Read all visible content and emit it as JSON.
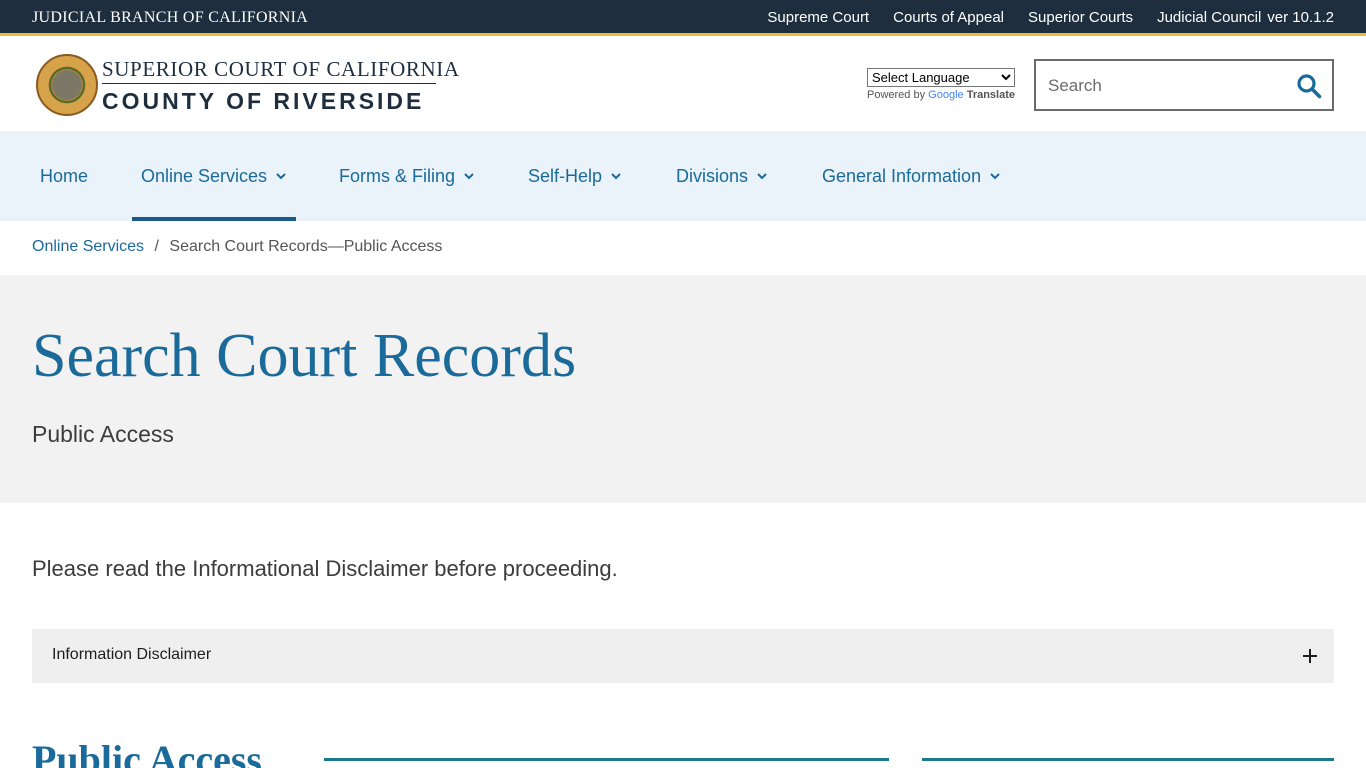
{
  "topbar": {
    "brand": "JUDICIAL BRANCH OF CALIFORNIA",
    "links": [
      "Supreme Court",
      "Courts of Appeal",
      "Superior Courts",
      "Judicial Council"
    ],
    "version": "ver 10.1.2"
  },
  "header": {
    "logo_line1": "SUPERIOR COURT OF CALIFORNIA",
    "logo_line2": "COUNTY OF RIVERSIDE",
    "language_select": "Select Language",
    "powered_by": "Powered by",
    "google": "Google",
    "translate": "Translate",
    "search_placeholder": "Search"
  },
  "nav": {
    "items": [
      {
        "label": "Home"
      },
      {
        "label": "Online Services"
      },
      {
        "label": "Forms & Filing"
      },
      {
        "label": "Self-Help"
      },
      {
        "label": "Divisions"
      },
      {
        "label": "General Information"
      }
    ]
  },
  "breadcrumb": {
    "parent": "Online Services",
    "separator": "/",
    "current": "Search Court Records—Public Access"
  },
  "hero": {
    "title": "Search Court Records",
    "subtitle": "Public Access"
  },
  "main": {
    "intro": "Please read the Informational Disclaimer before proceeding.",
    "accordion_label": "Information Disclaimer",
    "section_title": "Public Access"
  },
  "colors": {
    "topbar_bg": "#1e2e3e",
    "accent_gold": "#f0b93a",
    "link_blue": "#1a6a9a",
    "nav_bg": "#eaf2fa"
  }
}
